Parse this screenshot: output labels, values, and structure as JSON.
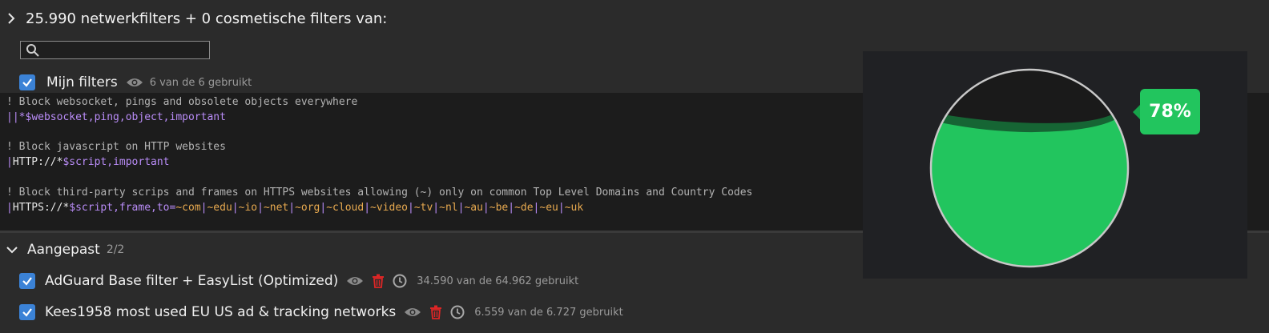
{
  "summary": {
    "text": "25.990 netwerkfilters  +  0 cosmetische filters van:"
  },
  "search": {
    "placeholder": "",
    "value": ""
  },
  "my_filters": {
    "label": "Mijn filters",
    "count_text": "6 van de 6 gebruikt",
    "checked": true
  },
  "editor_lines": [
    {
      "type": "comment",
      "text": "! Block websocket, pings and obsolete objects everywhere"
    },
    {
      "type": "rule1",
      "parts": [
        "||",
        "*",
        "$",
        "websocket,ping,object,important"
      ]
    },
    {
      "type": "blank",
      "text": ""
    },
    {
      "type": "comment",
      "text": "! Block javascript on HTTP websites"
    },
    {
      "type": "rule2",
      "parts": [
        "|",
        "HTTP://",
        "*",
        "$",
        "script,important"
      ]
    },
    {
      "type": "blank",
      "text": ""
    },
    {
      "type": "comment",
      "text": "! Block third-party scrips and frames on HTTPS websites allowing (~) only on common Top Level Domains and Country Codes"
    },
    {
      "type": "rule3",
      "parts": [
        "|",
        "HTTPS://",
        "*",
        "$",
        "script,frame,to=",
        "~com",
        "|",
        "~edu",
        "|",
        "~io",
        "|",
        "~net",
        "|",
        "~org",
        "|",
        "~cloud",
        "|",
        "~video",
        "|",
        "~tv",
        "|",
        "~nl",
        "|",
        "~au",
        "|",
        "~be",
        "|",
        "~de",
        "|",
        "~eu",
        "|",
        "~uk"
      ]
    }
  ],
  "group": {
    "label": "Aangepast",
    "count": "2/2",
    "items": [
      {
        "label": "AdGuard Base filter + EasyList (Optimized)",
        "count_text": "34.590 van de 64.962 gebruikt",
        "checked": true
      },
      {
        "label": "Kees1958 most used EU US ad & tracking networks",
        "count_text": "6.559 van de 6.727 gebruikt",
        "checked": true
      }
    ]
  },
  "gauge": {
    "percent": 78,
    "label": "78%",
    "colors": {
      "fill": "#22c55e",
      "empty": "#1a1a1a",
      "border": "#c8c8c8",
      "dark_band": "#166534"
    }
  },
  "colors": {
    "background": "#2b2b2b",
    "editor_bg": "#1c1c1c",
    "checkbox": "#3b82d6",
    "operator": "#b98cf7",
    "domain": "#e7a94f",
    "trash": "#dc2626"
  },
  "icons": [
    "chevron-right-icon",
    "search-icon",
    "checkbox-checked-icon",
    "eye-icon",
    "chevron-down-icon",
    "trash-icon",
    "clock-icon"
  ]
}
